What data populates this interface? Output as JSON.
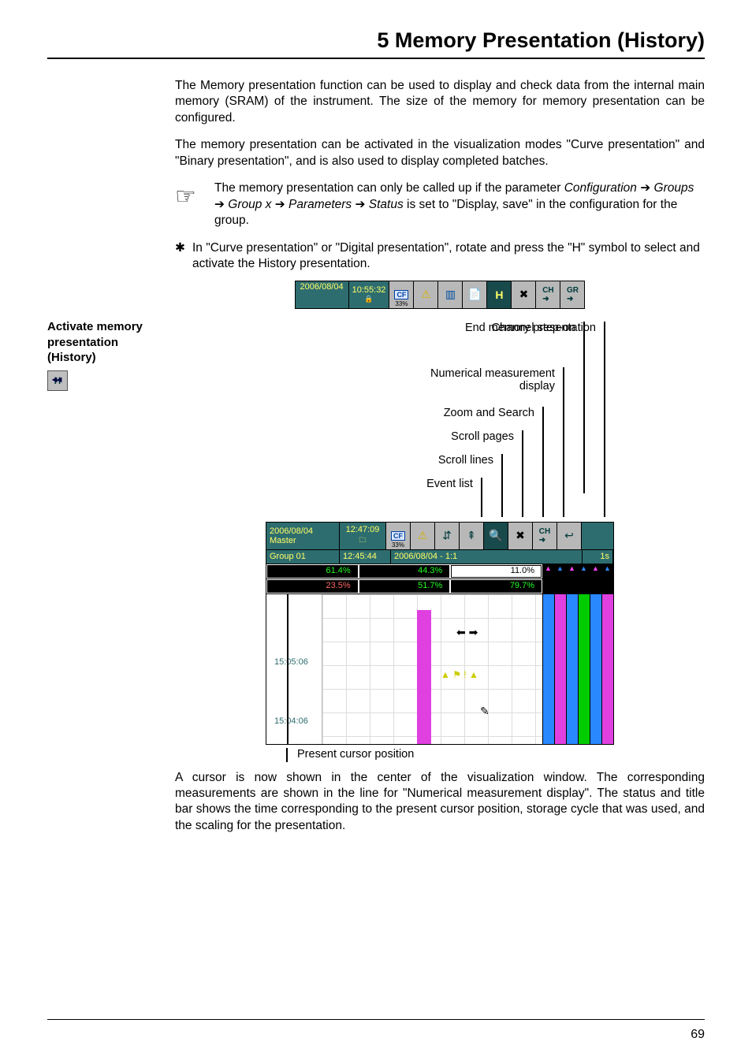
{
  "chapter_title": "5 Memory Presentation (History)",
  "para1": "The Memory presentation function can be used to display and check data from the internal main memory (SRAM) of the instrument. The size of the memory for memory presentation can be configured.",
  "para2": "The memory presentation can be activated in the visualization modes  \"Curve presentation\" and \"Binary presentation\", and is also used to display completed batches.",
  "note": "The memory presentation can only be called up if the parameter Configuration ➔ Groups ➔ Group x ➔ Parameters ➔ Status is set to \"Display, save\" in the configuration for the group.",
  "side_label": "Activate memory presentation (History)",
  "bullet": "In \"Curve presentation\" or \"Digital presentation\", rotate and press the \"H\" symbol to select and activate the History presentation.",
  "toolbar1": {
    "date": "2006/08/04",
    "time": "10:55:32",
    "pct": "33%"
  },
  "callouts": {
    "c1": "End memory presentation",
    "c2": "Channel step-on",
    "c3a": "Numerical measurement",
    "c3b": "display",
    "c4": "Zoom and Search",
    "c5": "Scroll pages",
    "c6": "Scroll lines",
    "c7": "Event list"
  },
  "toolbar2": {
    "date": "2006/08/04",
    "master": "Master",
    "time": "12:47:09",
    "pct": "33%",
    "group_label": "Group 01",
    "group_time": "12:45:44",
    "group_date": "2006/08/04 - 1:1",
    "group_interval": "1s",
    "vals_top": [
      "61.4%",
      "44.3%",
      "11.0%"
    ],
    "vals_bottom": [
      "23.5%",
      "51.7%",
      "79.7%"
    ]
  },
  "ticks": {
    "t1": "15:05:06",
    "t2": "15:04:06"
  },
  "caption": "Present cursor position",
  "para3": "A cursor is now shown in the center of the visualization window. The corresponding measurements are shown in the line for \"Numerical measurement display\". The status and title bar shows the time corresponding to the present cursor position, storage cycle that was used, and the scaling for the presentation.",
  "pagenum": "69"
}
